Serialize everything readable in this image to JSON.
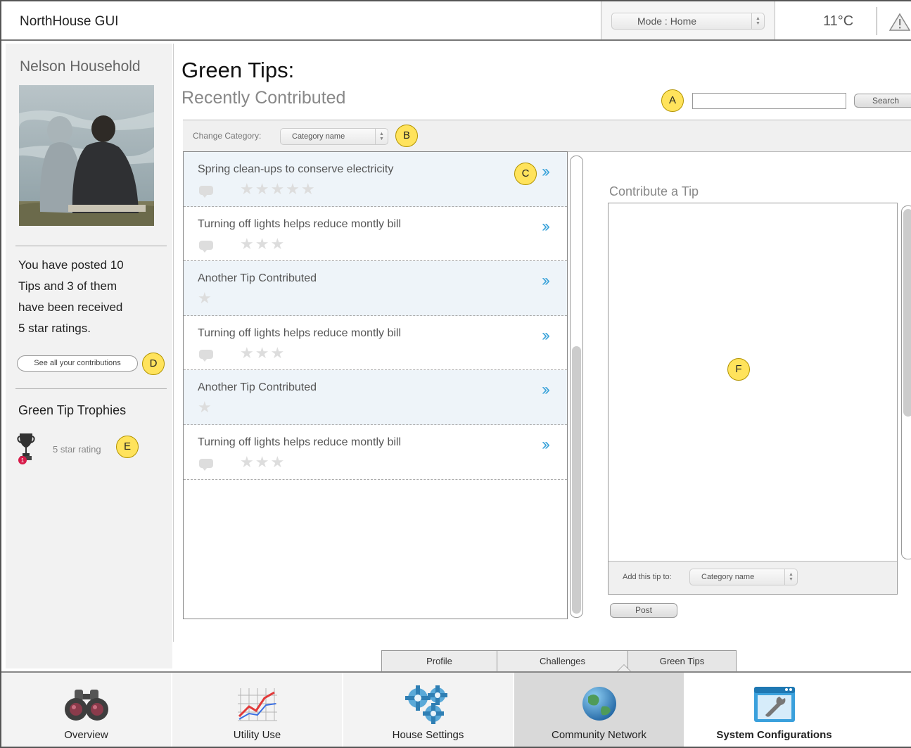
{
  "app": {
    "title": "NorthHouse GUI"
  },
  "topbar": {
    "mode": "Mode : Home",
    "temperature": "11°C"
  },
  "sidebar": {
    "household": "Nelson Household",
    "posted_line1": "You have posted 10",
    "posted_line2": "Tips and 3 of them",
    "posted_line3": "have been received",
    "posted_line4": "5 star ratings.",
    "contributions_button": "See all your contributions",
    "trophies_title": "Green Tip Trophies",
    "trophy_label": "5 star rating",
    "trophy_badge": "1"
  },
  "markers": {
    "a": "A",
    "b": "B",
    "c": "C",
    "d": "D",
    "e": "E",
    "f": "F"
  },
  "main": {
    "title": "Green Tips:",
    "subtitle": "Recently Contributed",
    "search_button": "Search",
    "search_value": "",
    "change_category_label": "Change Category:",
    "category_value": "Category name",
    "tips": [
      {
        "text": "Spring clean-ups to conserve electricity",
        "stars": 5,
        "comment": true
      },
      {
        "text": "Turning off lights helps reduce montly bill",
        "stars": 3,
        "comment": true
      },
      {
        "text": "Another Tip Contributed",
        "stars": 1,
        "comment": false
      },
      {
        "text": "Turning off lights helps reduce montly bill",
        "stars": 3,
        "comment": true
      },
      {
        "text": "Another Tip Contributed",
        "stars": 1,
        "comment": false
      },
      {
        "text": "Turning off lights helps reduce montly bill",
        "stars": 3,
        "comment": true
      }
    ],
    "contribute_title": "Contribute a Tip",
    "add_tip_label": "Add this tip to:",
    "add_category_value": "Category name",
    "post_button": "Post"
  },
  "subtabs": [
    "Profile",
    "Challenges",
    "Green Tips"
  ],
  "nav": [
    "Overview",
    "Utility Use",
    "House Settings",
    "Community Network",
    "System Configurations"
  ],
  "colors": {
    "accent": "#3ba3da",
    "marker": "#ffe35c",
    "badge": "#d81b4a"
  }
}
